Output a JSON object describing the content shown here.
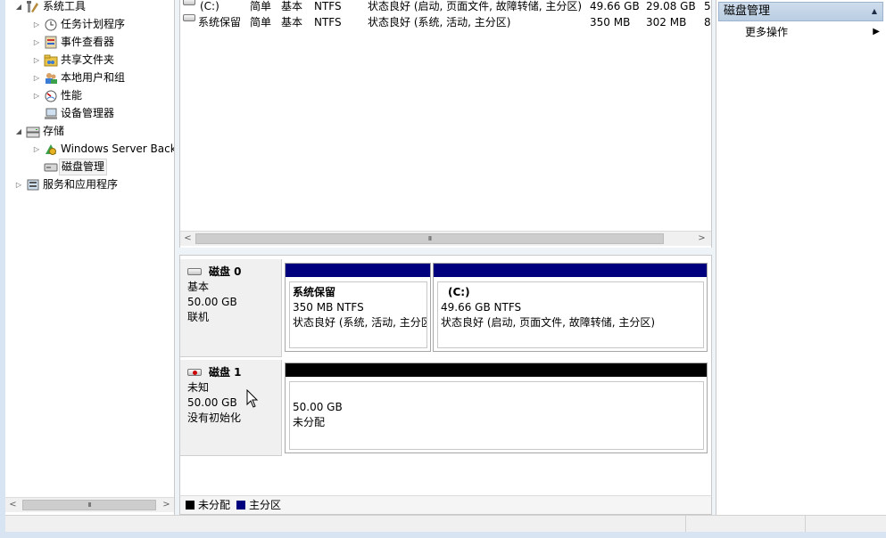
{
  "tree": {
    "items": [
      {
        "label": "系统工具",
        "icon": "system-tools-icon",
        "expander": "◢"
      },
      {
        "label": "任务计划程序",
        "icon": "task-scheduler-icon",
        "expander": "▷"
      },
      {
        "label": "事件查看器",
        "icon": "event-viewer-icon",
        "expander": "▷"
      },
      {
        "label": "共享文件夹",
        "icon": "shared-folders-icon",
        "expander": "▷"
      },
      {
        "label": "本地用户和组",
        "icon": "local-users-groups-icon",
        "expander": "▷"
      },
      {
        "label": "性能",
        "icon": "performance-icon",
        "expander": "▷"
      },
      {
        "label": "设备管理器",
        "icon": "device-manager-icon",
        "expander": ""
      },
      {
        "label": "存储",
        "icon": "storage-icon",
        "expander": "◢"
      },
      {
        "label": "Windows Server Backup",
        "icon": "windows-server-backup-icon",
        "expander": "▷"
      },
      {
        "label": "磁盘管理",
        "icon": "disk-management-icon",
        "expander": ""
      },
      {
        "label": "服务和应用程序",
        "icon": "services-applications-icon",
        "expander": "▷"
      }
    ]
  },
  "volumes": [
    {
      "name": "(C:)",
      "layout": "简单",
      "type": "基本",
      "fs": "NTFS",
      "status": "状态良好 (启动, 页面文件, 故障转储, 主分区)",
      "capacity": "49.66 GB",
      "free": "29.08 GB",
      "pct": "5"
    },
    {
      "name": "系统保留",
      "layout": "简单",
      "type": "基本",
      "fs": "NTFS",
      "status": "状态良好 (系统, 活动, 主分区)",
      "capacity": "350 MB",
      "free": "302 MB",
      "pct": "8"
    }
  ],
  "disks": [
    {
      "title": "磁盘 0",
      "kind": "基本",
      "size": "50.00 GB",
      "state": "联机",
      "partitions": [
        {
          "name": "系统保留",
          "size_fs": "350 MB NTFS",
          "status": "状态良好 (系统, 活动, 主分区)",
          "bar_color": "#00007f"
        },
        {
          "name": "(C:)",
          "size_fs": "49.66 GB NTFS",
          "status": "状态良好 (启动, 页面文件, 故障转储, 主分区)",
          "bar_color": "#00007f"
        }
      ]
    },
    {
      "title": "磁盘 1",
      "kind": "未知",
      "size": "50.00 GB",
      "state": "没有初始化",
      "partitions": [
        {
          "name": "",
          "size_fs": "50.00 GB",
          "status": "未分配",
          "bar_color": "#000000"
        }
      ]
    }
  ],
  "legend": [
    {
      "label": "未分配",
      "color": "#000000"
    },
    {
      "label": "主分区",
      "color": "#00007f"
    }
  ],
  "actions": {
    "header": "磁盘管理",
    "more": "更多操作"
  }
}
